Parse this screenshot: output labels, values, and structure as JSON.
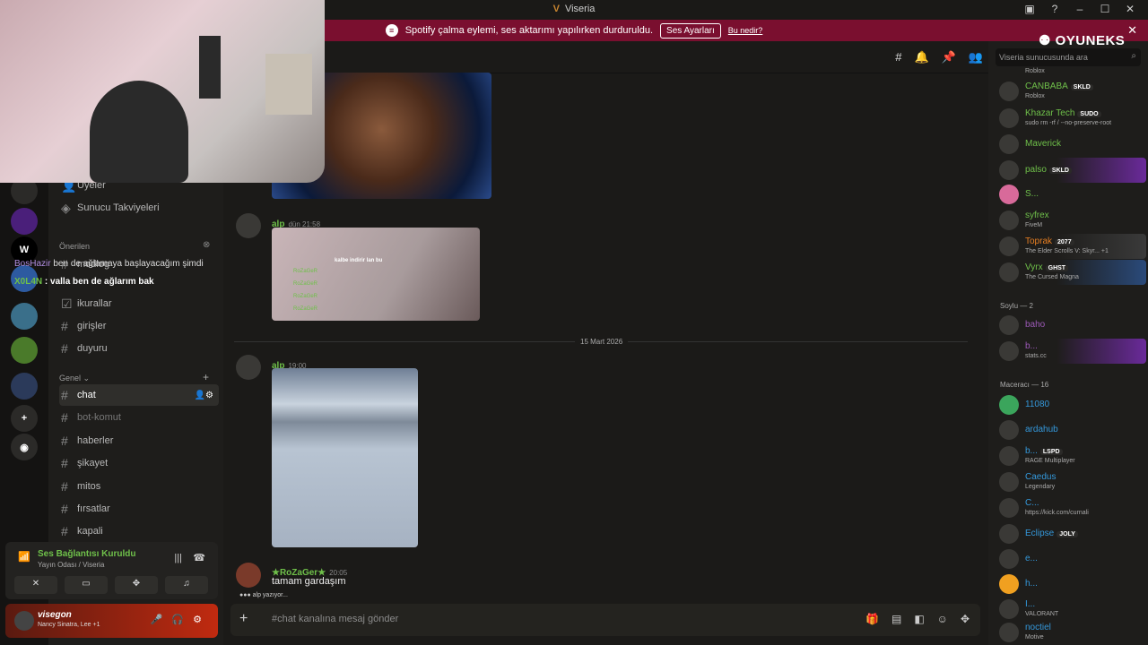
{
  "app": {
    "title": "Viseria",
    "logo_glyph": "V"
  },
  "titlebar": {
    "icons": [
      "inbox-icon",
      "help-icon",
      "minimize-icon",
      "maximize-icon",
      "close-icon"
    ]
  },
  "banner": {
    "text": "Spotify çalma eylemi, ses aktarımı yapılırken durduruldu.",
    "button": "Ses Ayarları",
    "link": "Bu nedir?"
  },
  "overlay": {
    "brand": "OYUNEKS",
    "chat": [
      {
        "user": "BosHazir",
        "text": "ben de ağlamaya başlayacağım şimdi",
        "color": "#b08de0"
      },
      {
        "user": "X0L4N",
        "text": ": valla ben de ağlarım bak",
        "color": "#6fc04a"
      }
    ]
  },
  "sidebar": {
    "top_items": [
      {
        "label": "Üyeler",
        "icon": "members-icon"
      },
      {
        "label": "Sunucu Takviyeleri",
        "icon": "boost-icon"
      }
    ],
    "recommended_label": "Önerilen",
    "recommended": [
      {
        "label": "modlog",
        "icon": "hash"
      },
      {
        "label": "ikurallar",
        "icon": "rules-icon"
      },
      {
        "label": "girişler",
        "icon": "hash"
      },
      {
        "label": "duyuru",
        "icon": "hash"
      }
    ],
    "category": "Genel",
    "channels": [
      {
        "label": "chat",
        "active": true
      },
      {
        "label": "bot-komut",
        "muted": true
      },
      {
        "label": "haberler"
      },
      {
        "label": "şikayet"
      },
      {
        "label": "mitos"
      },
      {
        "label": "fırsatlar"
      },
      {
        "label": "kapali"
      }
    ],
    "voice": {
      "status": "Ses Bağlantısı Kuruldu",
      "channel": "Yayın Odası / Viseria"
    },
    "user": {
      "name": "visegon",
      "status": "Nancy Sinatra, Lee +1"
    }
  },
  "messages": [
    {
      "user": "alp",
      "time": "dün 21:58",
      "embed_caption": "kalbe indirir lan bu"
    },
    {
      "date_divider": "15 Mart 2026"
    },
    {
      "user": "alp",
      "time": "19:00"
    },
    {
      "user": "★RoZaGer★",
      "time": "20:05",
      "text": "tamam gardaşım"
    }
  ],
  "typing": "alp yazıyor...",
  "embed_chat_names": [
    "RoZaGeR",
    "RoZaGeR",
    "RoZaGeR",
    "RoZaGeR"
  ],
  "composer": {
    "placeholder": "#chat kanalına mesaj gönder"
  },
  "members_panel": {
    "search_placeholder": "Viseria sunucusunda ara",
    "top_sub": "Roblox",
    "members": [
      {
        "name": "CANBABA",
        "tag": "SKLD",
        "sub": "Roblox",
        "color": "#6fc04a"
      },
      {
        "name": "Khazar Tech",
        "tag": "SUDO",
        "sub": "sudo rm -rf / --no-preserve-root",
        "color": "#6fc04a"
      },
      {
        "name": "Maverick",
        "color": "#6fc04a"
      },
      {
        "name": "palso",
        "tag": "SKLD",
        "color": "#6fc04a"
      },
      {
        "name": "S...",
        "color": "#6fc04a"
      },
      {
        "name": "syfrex",
        "sub": "FiveM",
        "color": "#6fc04a"
      },
      {
        "name": "Toprak",
        "tag": "2077",
        "sub": "The Elder Scrolls V: Skyr... +1",
        "color": "#e67e22"
      },
      {
        "name": "Vyrx",
        "tag": "GHST",
        "sub": "The Cursed Magna",
        "color": "#6fc04a"
      }
    ],
    "group2": "Soylu — 2",
    "group2_members": [
      {
        "name": "baho",
        "color": "#9b59b6"
      },
      {
        "name": "b...",
        "sub": "stats.cc",
        "color": "#9b59b6"
      }
    ],
    "group3": "Maceracı — 16",
    "group3_members": [
      {
        "name": "11080",
        "color": "#3498db"
      },
      {
        "name": "ardahub",
        "color": "#3498db"
      },
      {
        "name": "b...",
        "tag": "LSPD",
        "sub": "RAGE Multiplayer",
        "color": "#3498db"
      },
      {
        "name": "Caedus",
        "sub": "Legendary",
        "color": "#3498db"
      },
      {
        "name": "C...",
        "sub": "https://kick.com/curnali",
        "color": "#3498db"
      },
      {
        "name": "Eclipse",
        "tag": "JOLY",
        "color": "#3498db"
      },
      {
        "name": "e...",
        "color": "#3498db"
      },
      {
        "name": "h...",
        "color": "#3498db"
      },
      {
        "name": "I...",
        "sub": "VALORANT",
        "color": "#3498db"
      },
      {
        "name": "noctiel",
        "sub": "Motive",
        "color": "#3498db"
      }
    ]
  }
}
